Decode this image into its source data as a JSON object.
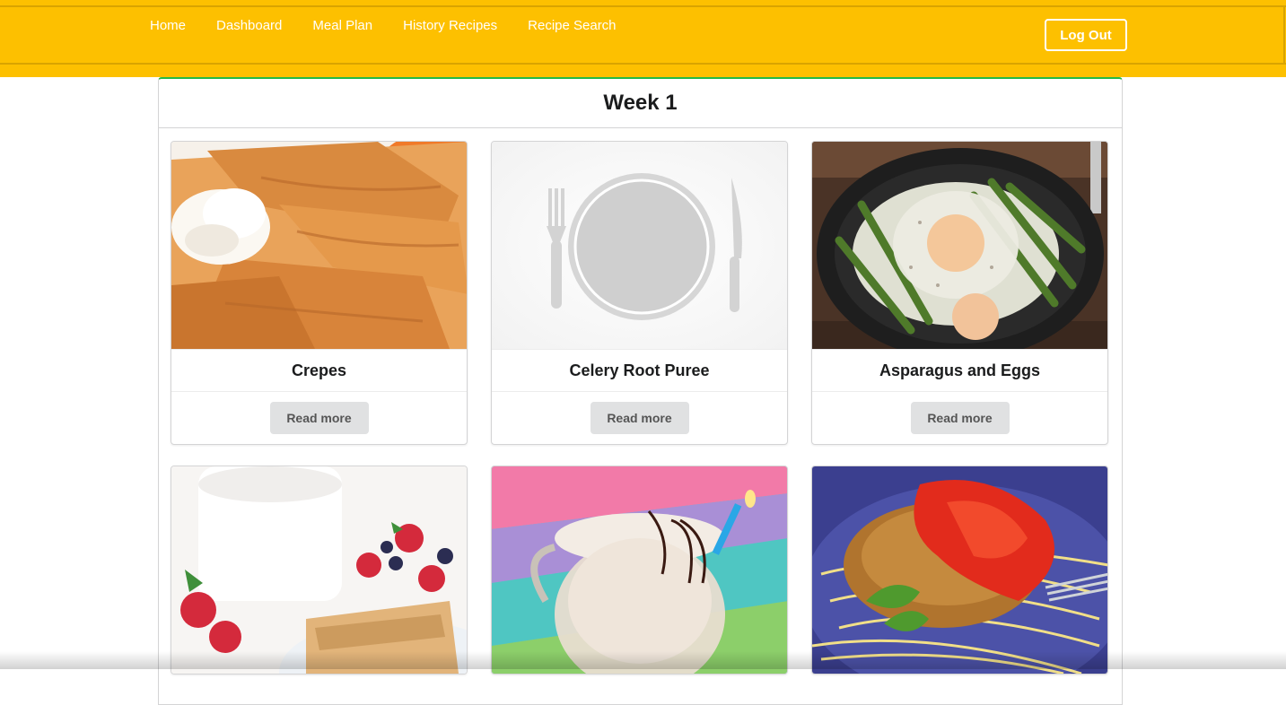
{
  "nav": {
    "items": [
      {
        "label": "Home"
      },
      {
        "label": "Dashboard"
      },
      {
        "label": "Meal Plan"
      },
      {
        "label": "History Recipes"
      },
      {
        "label": "Recipe Search"
      }
    ],
    "logout_label": "Log Out"
  },
  "panel": {
    "title": "Week 1"
  },
  "recipes": [
    {
      "title": "Crepes",
      "button": "Read more",
      "image": "crepes-photo"
    },
    {
      "title": "Celery Root Puree",
      "button": "Read more",
      "image": "plate-placeholder-icon"
    },
    {
      "title": "Asparagus and Eggs",
      "button": "Read more",
      "image": "asparagus-eggs-photo"
    },
    {
      "title": "",
      "button": "",
      "image": "pancakes-berries-photo"
    },
    {
      "title": "",
      "button": "",
      "image": "coconut-drink-photo"
    },
    {
      "title": "",
      "button": "",
      "image": "chicken-spaghetti-photo"
    }
  ],
  "colors": {
    "navbar": "#fdc000",
    "panel_accent": "#21ba45",
    "button_bg": "#e0e1e2"
  }
}
